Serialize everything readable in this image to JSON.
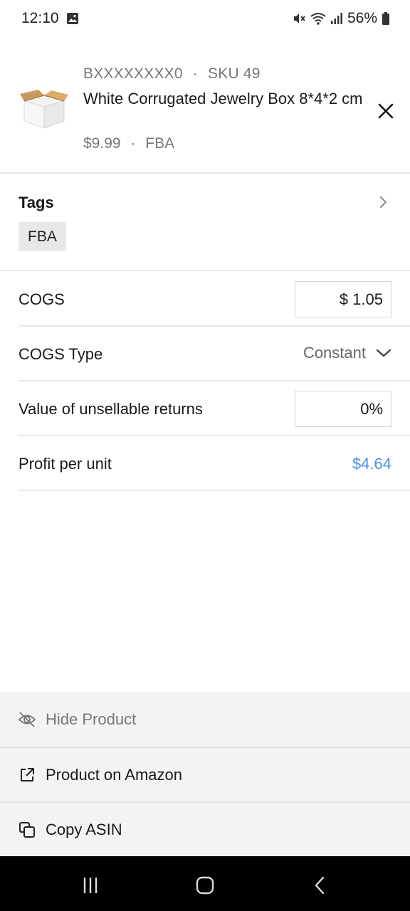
{
  "status_bar": {
    "time": "12:10",
    "battery": "56%"
  },
  "product": {
    "asin": "BXXXXXXXX0",
    "separator": "·",
    "sku": "SKU 49",
    "title": "White Corrugated Jewelry Box 8*4*2 cm",
    "price": "$9.99",
    "fulfillment": "FBA"
  },
  "tags": {
    "label": "Tags",
    "items": [
      "FBA"
    ]
  },
  "fields": {
    "cogs": {
      "label": "COGS",
      "value": "$ 1.05"
    },
    "cogs_type": {
      "label": "COGS Type",
      "value": "Constant"
    },
    "unsellable": {
      "label": "Value of unsellable returns",
      "value": "0%"
    },
    "profit": {
      "label": "Profit per unit",
      "value": "$4.64"
    }
  },
  "actions": {
    "hide": "Hide Product",
    "amazon": "Product on Amazon",
    "copy": "Copy ASIN"
  },
  "colors": {
    "accent": "#4a90e2",
    "divider": "#e8e8e8",
    "actions_bg": "#f3f3f3"
  },
  "icons": [
    "image-icon",
    "mute-icon",
    "wifi-icon",
    "signal-icon",
    "battery-icon",
    "close-icon",
    "chevron-right-icon",
    "chevron-down-icon",
    "eye-off-icon",
    "external-link-icon",
    "copy-icon",
    "recents-icon",
    "home-icon",
    "back-icon"
  ]
}
